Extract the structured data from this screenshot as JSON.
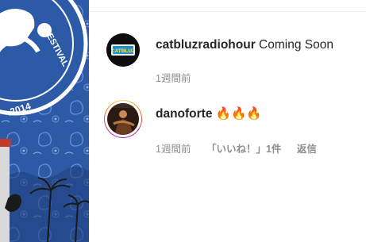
{
  "media": {
    "badge_text": "FESTIVAL",
    "badge_year": ".2014",
    "colors": {
      "bandana": "#2d5aa6",
      "bandana_dark": "#1f417e",
      "badge": "#ffffff"
    }
  },
  "comments": [
    {
      "username": "catbluzradiohour",
      "text": "Coming Soon",
      "avatar_text": "CATBLUZ",
      "time": "1週間前"
    },
    {
      "username": "danoforte",
      "text": "🔥🔥🔥",
      "time": "1週間前",
      "likes": "「いいね！」1件",
      "reply": "返信"
    }
  ],
  "colors": {
    "text": "#262626",
    "secondary": "#8e8e8e",
    "divider": "#efefef"
  }
}
